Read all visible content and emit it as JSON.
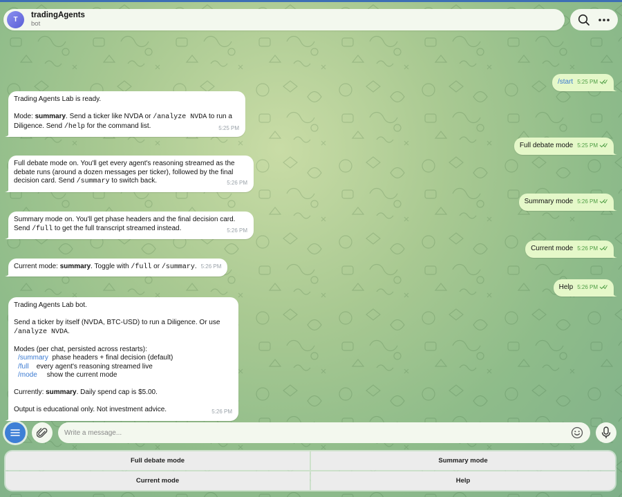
{
  "header": {
    "avatar_letter": "T",
    "title": "tradingAgents",
    "subtitle": "bot"
  },
  "icons": [
    "search-icon",
    "more-icon",
    "menu-icon",
    "paperclip-icon",
    "emoji-icon",
    "microphone-icon",
    "double-check-icon"
  ],
  "messages": {
    "m1": {
      "text": "/start",
      "time": "5:25 PM"
    },
    "m2": {
      "l1": "Trading Agents Lab is ready.",
      "p1": "Mode: ",
      "b1": "summary",
      "p2": ". Send a ticker like NVDA or ",
      "c1": "/analyze NVDA",
      "p3": " to run a Diligence. Send ",
      "c2": "/help",
      "p4": " for the command list.",
      "time": "5:25 PM"
    },
    "m3": {
      "text": "Full debate mode",
      "time": "5:25 PM"
    },
    "m4": {
      "p1": "Full debate mode on. You'll get every agent's reasoning streamed as the debate runs (around a dozen messages per ticker), followed by the final decision card. Send ",
      "c1": "/summary",
      "p2": " to switch back.",
      "time": "5:26 PM"
    },
    "m5": {
      "text": "Summary mode",
      "time": "5:26 PM"
    },
    "m6": {
      "p1": "Summary mode on. You'll get phase headers and the final decision card. Send ",
      "c1": "/full",
      "p2": " to get the full transcript streamed instead.",
      "time": "5:26 PM"
    },
    "m7": {
      "text": "Current mode",
      "time": "5:26 PM"
    },
    "m8": {
      "p1": "Current mode: ",
      "b1": "summary",
      "p2": ". Toggle with ",
      "c1": "/full",
      "p3": " or ",
      "c2": "/summary",
      "p4": ".",
      "time": "5:26 PM"
    },
    "m9": {
      "text": "Help",
      "time": "5:26 PM"
    },
    "m10": {
      "l1": "Trading Agents Lab bot.",
      "p1": "Send a ticker by itself (NVDA, BTC-USD) to run a Diligence. Or use ",
      "c1": "/analyze NVDA",
      "p2": ".",
      "modes_title": "Modes (per chat, persisted across restarts):",
      "cmd1": "/summary",
      "desc1": "phase headers + final decision (default)",
      "cmd2": "/full",
      "desc2": "every agent's reasoning streamed live",
      "cmd3": "/mode",
      "desc3": "show the current mode",
      "p3": "Currently: ",
      "b1": "summary",
      "p4": ". Daily spend cap is $5.00.",
      "l_last": "Output is educational only. Not investment advice.",
      "time": "5:26 PM"
    }
  },
  "composer": {
    "placeholder": "Write a message..."
  },
  "keyboard": {
    "buttons": [
      "Full debate mode",
      "Summary mode",
      "Current mode",
      "Help"
    ]
  },
  "colors": {
    "outgoing_bubble": "#e5f8c9",
    "incoming_bubble": "#ffffff",
    "accent": "#3e7fd6",
    "link": "#3a7ad1"
  }
}
